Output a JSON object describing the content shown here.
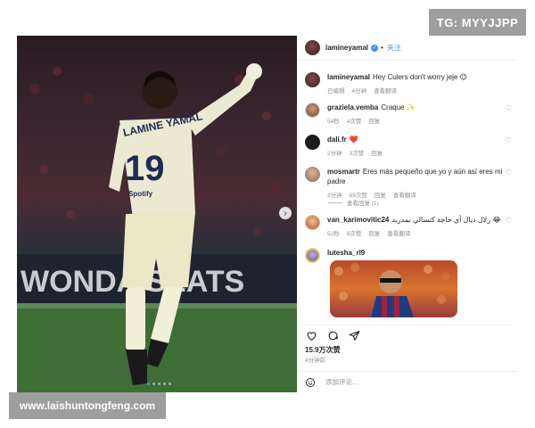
{
  "watermark": {
    "top_right": "TG: MYYJJPP",
    "bottom_left": "www.laishuntongfeng.com"
  },
  "post": {
    "jersey_name": "LAMINE YAMAL",
    "jersey_number": "19",
    "sponsor": "Spotify",
    "stadium_banner": "WONDA SEATS",
    "carousel_dots": 5,
    "carousel_active": 1
  },
  "header": {
    "username": "lamineyamal",
    "follow_label": "关注"
  },
  "comments": [
    {
      "username": "lamineyamal",
      "text": "Hey Culers don't worry jeje 😉",
      "meta": [
        "已编辑",
        "4分钟",
        "查看翻译"
      ]
    },
    {
      "username": "graziela.vemba",
      "text": "Craque ✨",
      "meta": [
        "54秒",
        "4次赞",
        "回复"
      ]
    },
    {
      "username": "dali.fr",
      "text": "❤️",
      "meta": [
        "2分钟",
        "3次赞",
        "回复"
      ]
    },
    {
      "username": "mosmartr",
      "text": "Eres más pequeño que yo y aún así eres mi padre",
      "meta": [
        "3分钟",
        "69次赞",
        "回复",
        "查看翻译"
      ]
    },
    {
      "username": "van_karimovitic24",
      "text": "زلال ديال أي حاجة كتسالي بمدريد 😂",
      "meta": [
        "52秒",
        "9次赞",
        "回复",
        "查看翻译"
      ]
    },
    {
      "username": "lutesha_rl9",
      "text": "",
      "meta": []
    }
  ],
  "view_replies": "查看回复 (1)",
  "footer": {
    "likes": "15.9万次赞",
    "time_ago": "4分钟前",
    "add_comment_placeholder": "添加评论..."
  },
  "icons": {
    "like": "heart-icon",
    "comment": "comment-icon",
    "share": "share-icon",
    "emoji": "smile-icon",
    "verified": "verified-icon",
    "next": "chevron-right-icon"
  },
  "colors": {
    "accent": "#3897f0",
    "muted": "#8e8e8e",
    "watermark_bg": "#9e9e9e"
  }
}
